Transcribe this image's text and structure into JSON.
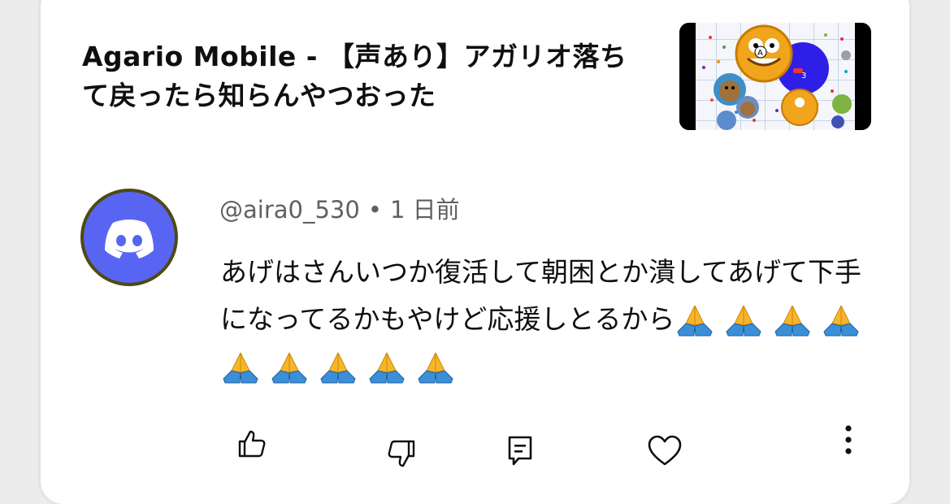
{
  "video": {
    "title": "Agario Mobile - 【声あり】アガリオ落ちて戻ったら知らんやつおった",
    "thumbnail_icon": "game-thumbnail"
  },
  "comment": {
    "author": "@aira0_530",
    "separator": "•",
    "time": "1 日前",
    "text": "あげはさんいつか復活して朝困とか潰してあげて下手になってるかもやけど応援しとるから",
    "emoji_count": 9,
    "emoji_name": "folded-hands-icon",
    "avatar_icon": "discord-icon"
  },
  "actions": {
    "like_icon": "thumbs-up-icon",
    "dislike_icon": "thumbs-down-icon",
    "reply_icon": "comment-icon",
    "heart_icon": "heart-icon",
    "more_icon": "more-vert-icon"
  },
  "colors": {
    "discord_blurple": "#5865f2",
    "text_primary": "#0f0f0f",
    "text_secondary": "#606060",
    "emoji_yellow": "#f7b52c",
    "emoji_blue": "#3b8fd9"
  }
}
